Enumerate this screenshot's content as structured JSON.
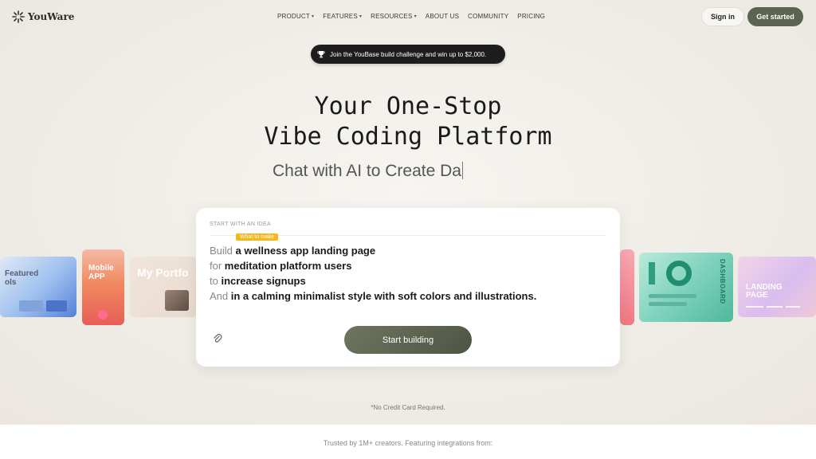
{
  "brand": {
    "name": "YouWare"
  },
  "nav": {
    "items": [
      {
        "label": "PRODUCT",
        "dropdown": true
      },
      {
        "label": "FEATURES",
        "dropdown": true
      },
      {
        "label": "RESOURCES",
        "dropdown": true
      },
      {
        "label": "ABOUT US",
        "dropdown": false
      },
      {
        "label": "COMMUNITY",
        "dropdown": false
      },
      {
        "label": "PRICING",
        "dropdown": false
      }
    ],
    "signin_label": "Sign in",
    "get_started_label": "Get started"
  },
  "banner": {
    "text": "Join the YouBase build challenge and win up to $2,000.",
    "icon": "trophy-icon"
  },
  "hero": {
    "title_line1": "Your One-Stop",
    "title_line2": "Vibe Coding Platform",
    "typing_text": "Chat with AI to Create Da"
  },
  "carousel": {
    "card1_text": "Featured\nols",
    "card2_text": "Mobile\nAPP",
    "card3_text": "My Portfo",
    "card5_text": "DASHBOARD",
    "card6_text": "LANDING\nPAGE"
  },
  "prompt": {
    "section_label": "START WITH AN IDEA",
    "tag": "What to make",
    "rows": [
      {
        "key": "Build",
        "value": "a wellness app landing page"
      },
      {
        "key": "for",
        "value": "meditation platform users"
      },
      {
        "key": "to",
        "value": "increase signups"
      },
      {
        "key": "And",
        "value": "in a calming minimalist style with soft colors and illustrations."
      }
    ],
    "start_label": "Start building"
  },
  "note": "*No Credit Card Required.",
  "trusted": "Trusted by 1M+ creators. Featuring integrations from:",
  "colors": {
    "accent": "#5a6450",
    "banner_bg": "#1d1d1d",
    "tag": "#f4b81c"
  }
}
